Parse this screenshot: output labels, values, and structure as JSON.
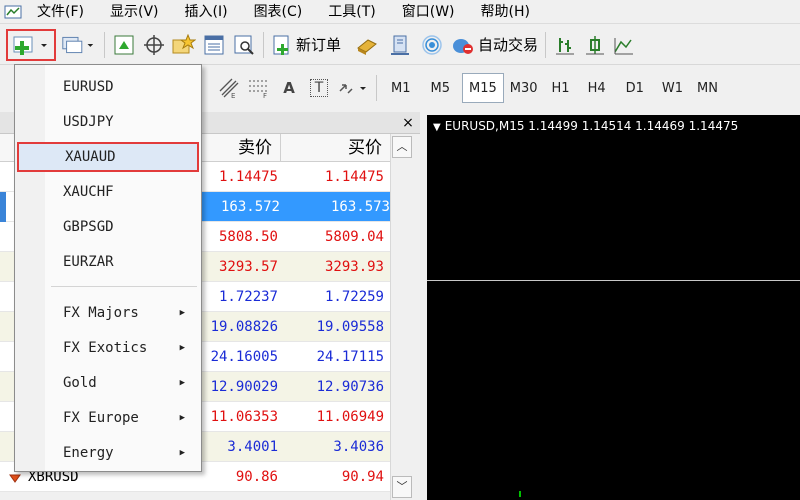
{
  "menubar": {
    "items": [
      "文件(F)",
      "显示(V)",
      "插入(I)",
      "图表(C)",
      "工具(T)",
      "窗口(W)",
      "帮助(H)"
    ]
  },
  "toolbar": {
    "new_order_label": "新订单",
    "auto_trade_label": "自动交易"
  },
  "drawing_tools": {
    "text_tool_label": "A",
    "text_label_tool": "T"
  },
  "timeframes": [
    "M1",
    "M5",
    "M15",
    "M30",
    "H1",
    "H4",
    "D1",
    "W1",
    "MN"
  ],
  "active_timeframe": "M15",
  "market_watch": {
    "close_label": "×",
    "bid_header": "卖价",
    "ask_header": "买价",
    "rows": [
      {
        "symbol": "",
        "bid": "1.14475",
        "ask": "1.14475",
        "color": "red"
      },
      {
        "symbol": "",
        "bid": "163.572",
        "ask": "163.573",
        "color": "selected"
      },
      {
        "symbol": "",
        "bid": "5808.50",
        "ask": "5809.04",
        "color": "red"
      },
      {
        "symbol": "",
        "bid": "3293.57",
        "ask": "3293.93",
        "color": "red"
      },
      {
        "symbol": "",
        "bid": "1.72237",
        "ask": "1.72259",
        "color": "blue"
      },
      {
        "symbol": "",
        "bid": "19.08826",
        "ask": "19.09558",
        "color": "blue"
      },
      {
        "symbol": "",
        "bid": "24.16005",
        "ask": "24.17115",
        "color": "blue"
      },
      {
        "symbol": "",
        "bid": "12.90029",
        "ask": "12.90736",
        "color": "blue"
      },
      {
        "symbol": "",
        "bid": "11.06353",
        "ask": "11.06949",
        "color": "red"
      },
      {
        "symbol": "",
        "bid": "3.4001",
        "ask": "3.4036",
        "color": "blue"
      },
      {
        "symbol": "XBRUSD",
        "bid": "90.86",
        "ask": "90.94",
        "color": "red"
      }
    ]
  },
  "chart": {
    "title": "EURUSD,M15  1.14499 1.14514 1.14469 1.14475"
  },
  "dropdown": {
    "symbols": [
      "EURUSD",
      "USDJPY",
      "XAUAUD",
      "XAUCHF",
      "GBPSGD",
      "EURZAR"
    ],
    "highlighted": "XAUAUD",
    "groups": [
      "FX Majors",
      "FX Exotics",
      "Gold",
      "FX Europe",
      "Energy"
    ]
  },
  "colors": {
    "blue_price": "#1a2bd6",
    "red_price": "#e01010",
    "selection": "#3399ff",
    "highlight_border": "#e23b3b"
  }
}
